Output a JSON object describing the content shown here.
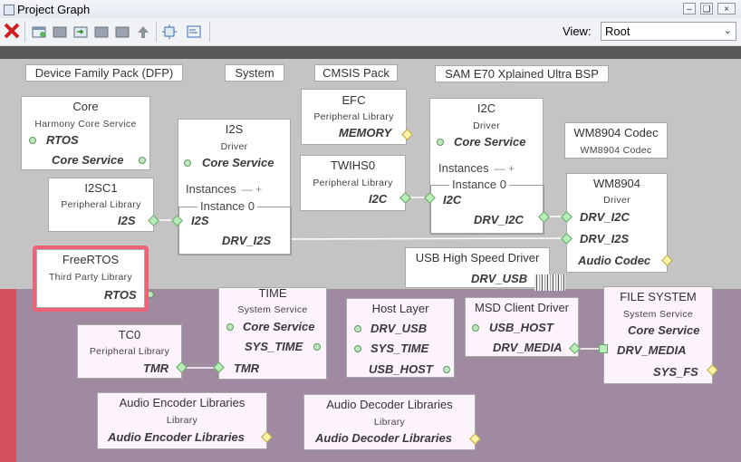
{
  "window": {
    "title": "Project Graph"
  },
  "toolbar": {
    "view_label": "View:",
    "view_value": "Root",
    "icons": [
      "close-x-icon",
      "new-graph-icon",
      "add-component-icon",
      "export-icon",
      "group-icon",
      "remove-icon",
      "move-up-icon",
      "fit-view-icon",
      "properties-icon"
    ]
  },
  "colors": {
    "close_red": "#cc1f1f",
    "upper_band": "#c4c4c4",
    "lower_band": "#a08aa2",
    "highlight": "#f06276",
    "port_green": "#b8ecb8",
    "port_yellow": "#fff3a6"
  },
  "groups": [
    {
      "label": "Device Family Pack (DFP)"
    },
    {
      "label": "System"
    },
    {
      "label": "CMSIS Pack"
    },
    {
      "label": "SAM E70 Xplained Ultra BSP"
    }
  ],
  "components": {
    "core": {
      "name": "Core",
      "kind": "Harmony Core Service",
      "rtos": "RTOS",
      "core_service": "Core Service"
    },
    "i2s": {
      "name": "I2S",
      "kind": "Driver",
      "core_service": "Core Service",
      "instances": "Instances",
      "instance0": "Instance 0",
      "cap_i2s": "I2S",
      "cap_drv": "DRV_I2S"
    },
    "i2sc1": {
      "name": "I2SC1",
      "kind": "Peripheral Library",
      "cap": "I2S"
    },
    "efc": {
      "name": "EFC",
      "kind": "Peripheral Library",
      "cap": "MEMORY"
    },
    "twihs0": {
      "name": "TWIHS0",
      "kind": "Peripheral Library",
      "cap": "I2C"
    },
    "i2c": {
      "name": "I2C",
      "kind": "Driver",
      "core_service": "Core Service",
      "instances": "Instances",
      "instance0": "Instance 0",
      "cap_i2c": "I2C",
      "cap_drv": "DRV_I2C"
    },
    "wm8904codec": {
      "name": "WM8904 Codec",
      "kind": "WM8904 Codec"
    },
    "wm8904": {
      "name": "WM8904",
      "kind": "Driver",
      "drv_i2c": "DRV_I2C",
      "drv_i2s": "DRV_I2S",
      "audio_codec": "Audio Codec"
    },
    "usbhs": {
      "name": "USB High Speed Driver",
      "cap": "DRV_USB"
    },
    "freertos": {
      "name": "FreeRTOS",
      "kind": "Third Party Library",
      "cap": "RTOS"
    },
    "time": {
      "name": "TIME",
      "kind": "System Service",
      "core_service": "Core Service",
      "sys_time": "SYS_TIME",
      "tmr": "TMR"
    },
    "hostlayer": {
      "name": "Host Layer",
      "drv_usb": "DRV_USB",
      "sys_time": "SYS_TIME",
      "usb_host": "USB_HOST"
    },
    "msd": {
      "name": "MSD Client Driver",
      "usb_host": "USB_HOST",
      "drv_media": "DRV_MEDIA"
    },
    "filesystem": {
      "name": "FILE SYSTEM",
      "kind": "System Service",
      "core_service": "Core Service",
      "drv_media": "DRV_MEDIA",
      "sys_fs": "SYS_FS"
    },
    "tc0": {
      "name": "TC0",
      "kind": "Peripheral Library",
      "cap": "TMR"
    },
    "audioenc": {
      "name": "Audio Encoder Libraries",
      "kind": "Library",
      "cap": "Audio Encoder Libraries"
    },
    "audiodec": {
      "name": "Audio Decoder Libraries",
      "kind": "Library",
      "cap": "Audio Decoder Libraries"
    }
  }
}
